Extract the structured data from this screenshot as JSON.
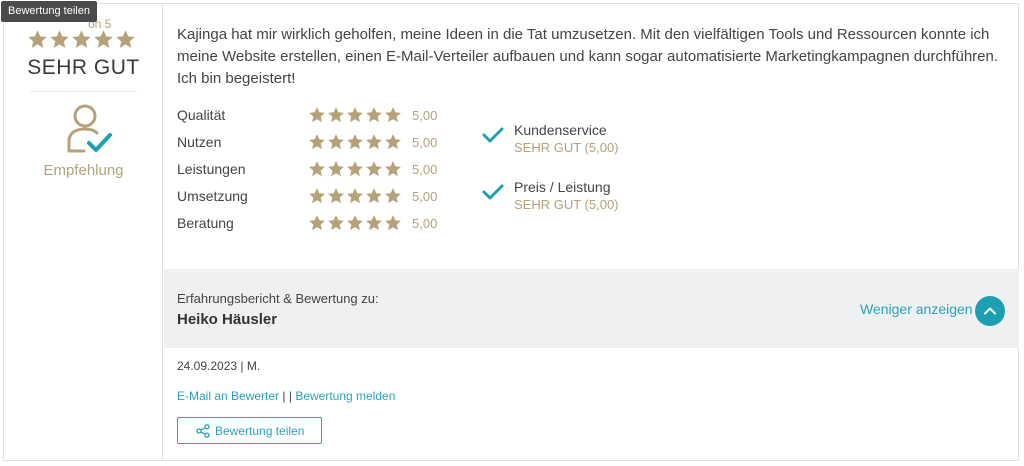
{
  "tooltip": {
    "text": "Bewertung teilen"
  },
  "summary": {
    "score_suffix": "on 5",
    "stars": 5,
    "verdict": "SEHR GUT",
    "recommendation_label": "Empfehlung"
  },
  "review": {
    "text": "Kajinga hat mir wirklich geholfen, meine Ideen in die Tat umzusetzen. Mit den vielfältigen Tools und Ressourcen konnte ich meine Website erstellen, einen E-Mail-Verteiler aufbauen und kann sogar automatisierte Marketingkampagnen durchführen. Ich bin begeistert!"
  },
  "ratings": [
    {
      "label": "Qualität",
      "stars": 5,
      "value": "5,00"
    },
    {
      "label": "Nutzen",
      "stars": 5,
      "value": "5,00"
    },
    {
      "label": "Leistungen",
      "stars": 5,
      "value": "5,00"
    },
    {
      "label": "Umsetzung",
      "stars": 5,
      "value": "5,00"
    },
    {
      "label": "Beratung",
      "stars": 5,
      "value": "5,00"
    }
  ],
  "extras": [
    {
      "label": "Kundenservice",
      "value": "SEHR GUT (5,00)"
    },
    {
      "label": "Preis / Leistung",
      "value": "SEHR GUT (5,00)"
    }
  ],
  "report": {
    "title": "Erfahrungsbericht & Bewertung zu:",
    "name": "Heiko Häusler",
    "toggle_label": "Weniger anzeigen"
  },
  "meta": {
    "date_author": "24.09.2023 | M.",
    "email_link": "E-Mail an Bewerter",
    "separator": "| |",
    "report_link": "Bewertung melden",
    "share_label": "Bewertung teilen"
  },
  "colors": {
    "gold": "#b5a279",
    "teal": "#1d9fb3",
    "link": "#2aa3b8",
    "bar_bg": "#eef0f2"
  },
  "icons": {
    "star": "star-icon",
    "recommendation": "person-check-icon",
    "check": "check-icon",
    "chevron": "chevron-up-icon",
    "share": "share-icon"
  }
}
